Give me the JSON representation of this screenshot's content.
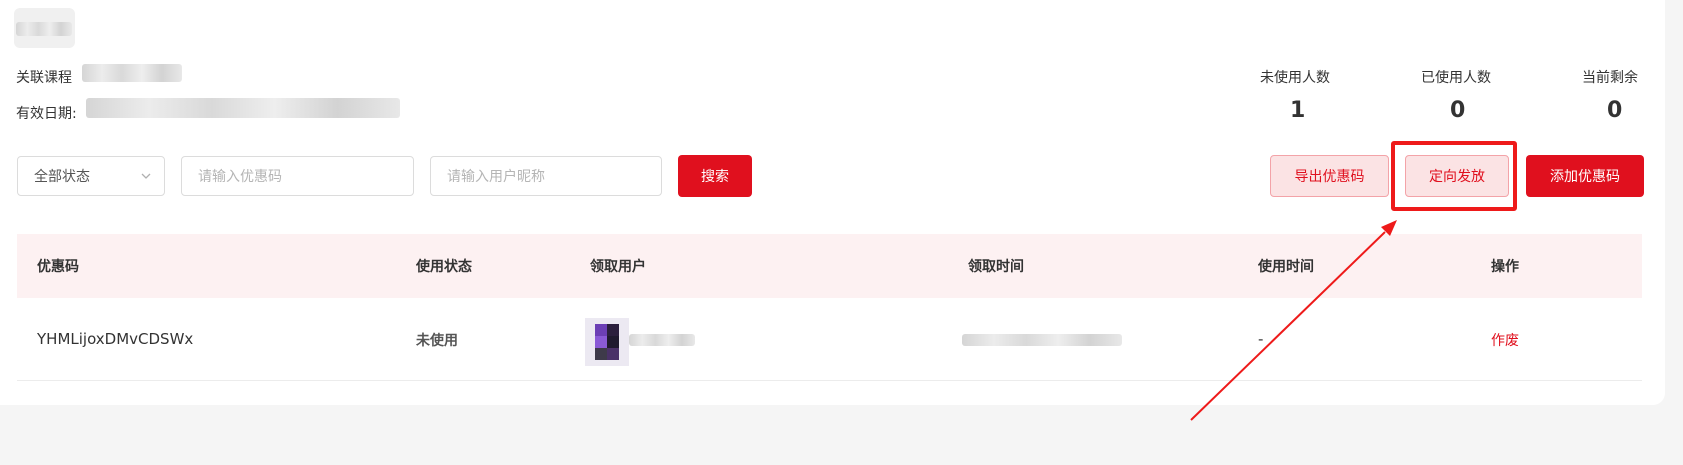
{
  "meta": {
    "course_label": "关联课程",
    "valid_date_label": "有效日期:"
  },
  "stats": [
    {
      "label": "未使用人数",
      "value": "1"
    },
    {
      "label": "已使用人数",
      "value": "0"
    },
    {
      "label": "当前剩余",
      "value": "0"
    }
  ],
  "filters": {
    "status_select": "全部状态",
    "coupon_placeholder": "请输入优惠码",
    "nickname_placeholder": "请输入用户昵称",
    "search_label": "搜索"
  },
  "actions": {
    "export_label": "导出优惠码",
    "targeted_label": "定向发放",
    "add_label": "添加优惠码"
  },
  "table": {
    "headers": [
      "优惠码",
      "使用状态",
      "领取用户",
      "领取时间",
      "使用时间",
      "操作"
    ],
    "rows": [
      {
        "code": "YHMLijoxDMvCDSWx",
        "status": "未使用",
        "use_time": "-",
        "action": "作废"
      }
    ]
  },
  "colors": {
    "accent": "#e0101e",
    "highlight": "#ee1a1a",
    "header_bg": "#fdf1f2"
  }
}
